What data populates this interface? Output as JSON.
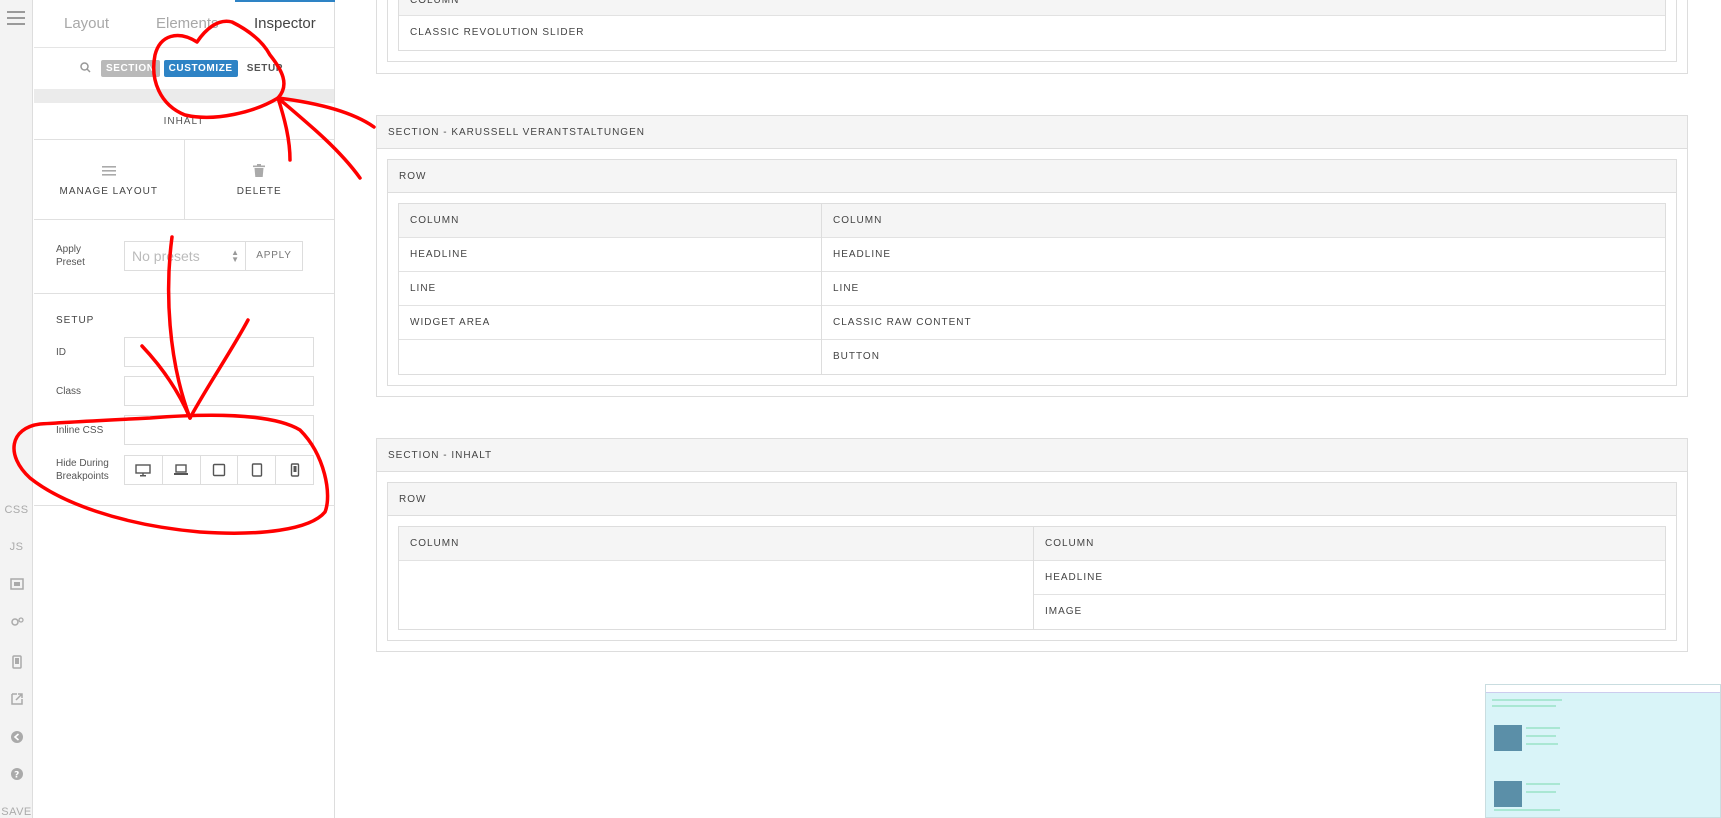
{
  "rail": {
    "css_label": "CSS",
    "js_label": "JS",
    "save_label": "SAVE"
  },
  "inspector": {
    "tabs": [
      {
        "label": "Layout"
      },
      {
        "label": "Elements"
      },
      {
        "label": "Inspector"
      }
    ],
    "breadcrumbs": {
      "section": "SECTION",
      "customize": "CUSTOMIZE",
      "setup": "SETUP"
    },
    "element_title": "INHALT",
    "manage_layout": "MANAGE LAYOUT",
    "delete": "DELETE",
    "apply_preset_label": "Apply Preset",
    "preset_placeholder": "No presets",
    "apply_button": "APPLY",
    "setup_heading": "SETUP",
    "id_label": "ID",
    "class_label": "Class",
    "inline_css_label": "Inline CSS",
    "hide_breakpoints_label": "Hide During Breakpoints"
  },
  "canvas": {
    "top_section": {
      "column_header": "COLUMN",
      "item": "CLASSIC REVOLUTION SLIDER"
    },
    "section2": {
      "title": "SECTION - KARUSSELL VERANTSTALTUNGEN",
      "row": "ROW",
      "columns": [
        {
          "header": "COLUMN",
          "items": [
            "HEADLINE",
            "LINE",
            "WIDGET AREA",
            ""
          ]
        },
        {
          "header": "COLUMN",
          "items": [
            "HEADLINE",
            "LINE",
            "CLASSIC RAW CONTENT",
            "BUTTON"
          ]
        }
      ]
    },
    "section3": {
      "title": "SECTION - INHALT",
      "row": "ROW",
      "columns": [
        {
          "header": "COLUMN",
          "items": [
            "",
            ""
          ]
        },
        {
          "header": "COLUMN",
          "items": [
            "HEADLINE",
            "IMAGE"
          ]
        }
      ]
    }
  },
  "colors": {
    "accent": "#2e83c5",
    "annotation": "#ff0000"
  }
}
